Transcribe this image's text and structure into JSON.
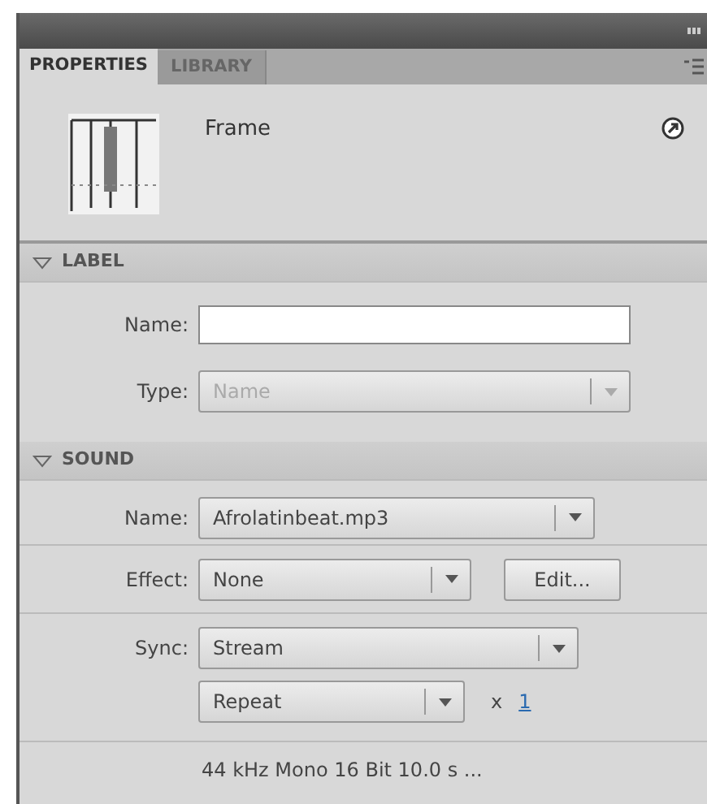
{
  "tabs": [
    {
      "label": "PROPERTIES",
      "selected": true
    },
    {
      "label": "LIBRARY",
      "selected": false
    }
  ],
  "header": {
    "title": "Frame"
  },
  "label_section": {
    "title": "LABEL",
    "expanded": true,
    "name": {
      "label": "Name:"
    },
    "type": {
      "label": "Type:",
      "value": "Name",
      "disabled": true
    }
  },
  "sound_section": {
    "title": "SOUND",
    "expanded": true,
    "name": {
      "label": "Name:",
      "value": "Afrolatinbeat.mp3"
    },
    "effect": {
      "label": "Effect:",
      "value": "None",
      "button": "Edit..."
    },
    "sync": {
      "label": "Sync:",
      "value": "Stream",
      "repeat": "Repeat",
      "times": "x",
      "count": "1"
    },
    "info": "44 kHz Mono 16 Bit 10.0 s ..."
  }
}
